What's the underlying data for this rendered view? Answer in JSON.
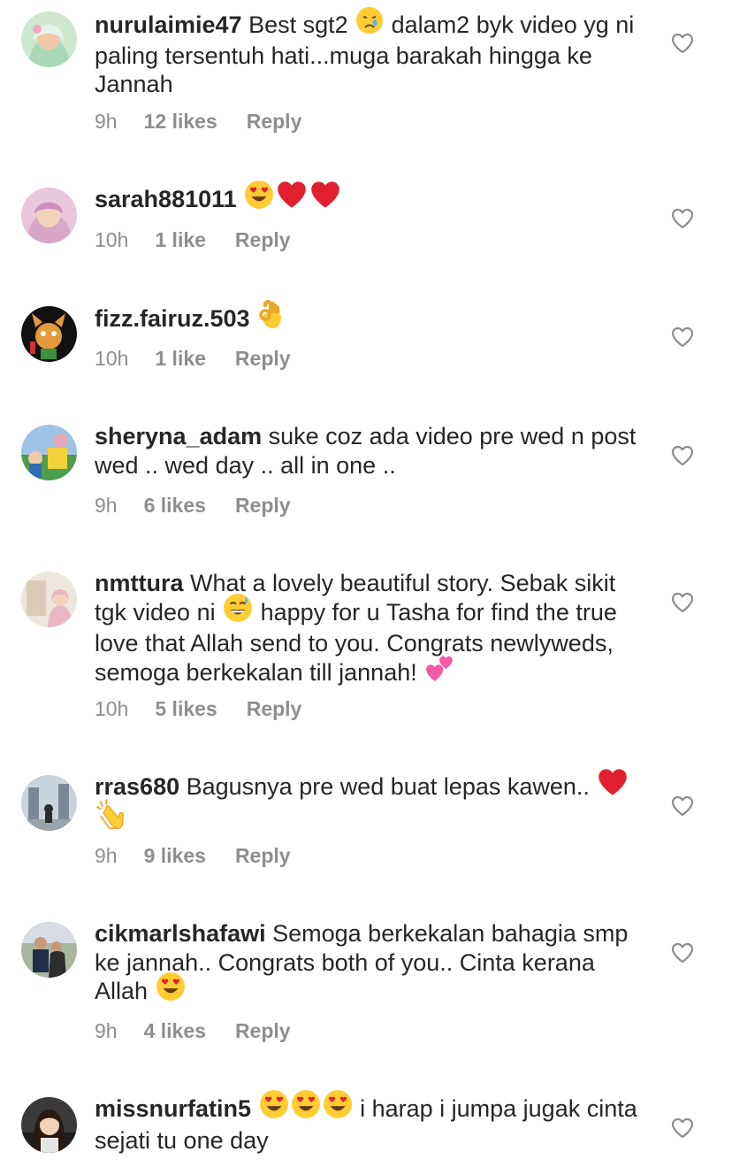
{
  "comments": [
    {
      "username": "nurulaimie47",
      "segments": [
        {
          "text": " Best sgt2 "
        },
        {
          "emoji": "crying-face"
        },
        {
          "text": " dalam2 byk video yg ni paling tersentuh hati...muga barakah hingga ke Jannah"
        }
      ],
      "time": "9h",
      "likes": "12 likes",
      "reply": "Reply"
    },
    {
      "username": "sarah881011",
      "segments": [
        {
          "text": " "
        },
        {
          "emoji": "heart-eyes-face"
        },
        {
          "emoji": "red-heart"
        },
        {
          "emoji": "red-heart"
        }
      ],
      "time": "10h",
      "likes": "1 like",
      "reply": "Reply"
    },
    {
      "username": "fizz.fairuz.503",
      "segments": [
        {
          "text": " "
        },
        {
          "emoji": "ok-hand"
        }
      ],
      "time": "10h",
      "likes": "1 like",
      "reply": "Reply"
    },
    {
      "username": "sheryna_adam",
      "segments": [
        {
          "text": " suke coz ada video pre wed n post wed .. wed day .. all in one .."
        }
      ],
      "time": "9h",
      "likes": "6 likes",
      "reply": "Reply"
    },
    {
      "username": "nmttura",
      "segments": [
        {
          "text": " What a lovely beautiful story. Sebak sikit tgk video ni "
        },
        {
          "emoji": "sweat-smile-face"
        },
        {
          "text": " happy for u Tasha for find the true love that Allah send to you. Congrats newlyweds, semoga berkekalan till jannah! "
        },
        {
          "emoji": "two-hearts"
        }
      ],
      "time": "10h",
      "likes": "5 likes",
      "reply": "Reply"
    },
    {
      "username": "rras680",
      "segments": [
        {
          "text": " Bagusnya pre wed buat lepas kawen.. "
        },
        {
          "emoji": "red-heart"
        },
        {
          "emoji": "clapping-hands"
        }
      ],
      "time": "9h",
      "likes": "9 likes",
      "reply": "Reply"
    },
    {
      "username": "cikmarlshafawi",
      "segments": [
        {
          "text": " Semoga berkekalan bahagia smp ke jannah.. Congrats both of you.. Cinta kerana Allah "
        },
        {
          "emoji": "heart-eyes-face"
        }
      ],
      "time": "9h",
      "likes": "4 likes",
      "reply": "Reply"
    },
    {
      "username": "missnurfatin5",
      "segments": [
        {
          "text": " "
        },
        {
          "emoji": "heart-eyes-face"
        },
        {
          "emoji": "heart-eyes-face"
        },
        {
          "emoji": "heart-eyes-face"
        },
        {
          "text": " i harap i jumpa jugak cinta sejati tu one day"
        }
      ],
      "time": "",
      "likes": "",
      "reply": ""
    }
  ],
  "icons": {
    "like": "heart-outline-icon"
  },
  "colors": {
    "text": "#262626",
    "meta": "#8e8e8e",
    "heart_outline": "#8e8e8e",
    "emoji_face": "#ffcc33",
    "emoji_heart": "#e0202e",
    "emoji_pink_heart": "#f35ba7"
  }
}
